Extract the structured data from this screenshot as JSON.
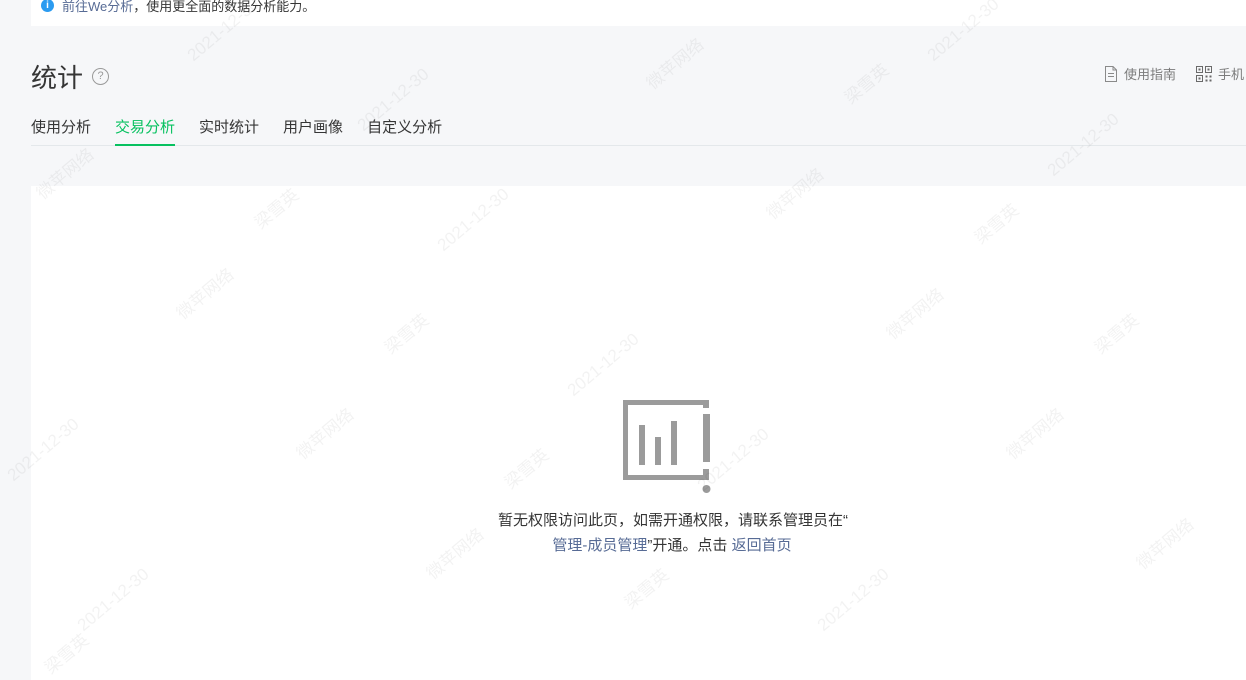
{
  "notice": {
    "icon": "info-icon",
    "link": "前往We分析",
    "text": "，使用更全面的数据分析能力。"
  },
  "page": {
    "title": "统计",
    "help_icon": "question-circle-icon"
  },
  "tools": {
    "guide": "使用指南",
    "mobile": "手机"
  },
  "tabs": [
    {
      "label": "使用分析",
      "active": false
    },
    {
      "label": "交易分析",
      "active": true
    },
    {
      "label": "实时统计",
      "active": false
    },
    {
      "label": "用户画像",
      "active": false
    },
    {
      "label": "自定义分析",
      "active": false
    }
  ],
  "empty": {
    "icon": "no-permission-chart-icon",
    "message": "暂无权限访问此页，如需开通权限，请联系管理员在“",
    "link_member": "管理-成员管理",
    "message_tail": "”开通。点击 ",
    "link_home": "返回首页"
  },
  "watermark": {
    "items": [
      "微苹网络",
      "梁雪英",
      "2021-12-30"
    ]
  },
  "colors": {
    "accent": "#07c160",
    "link": "#576b95",
    "info": "#2b9bf0"
  }
}
